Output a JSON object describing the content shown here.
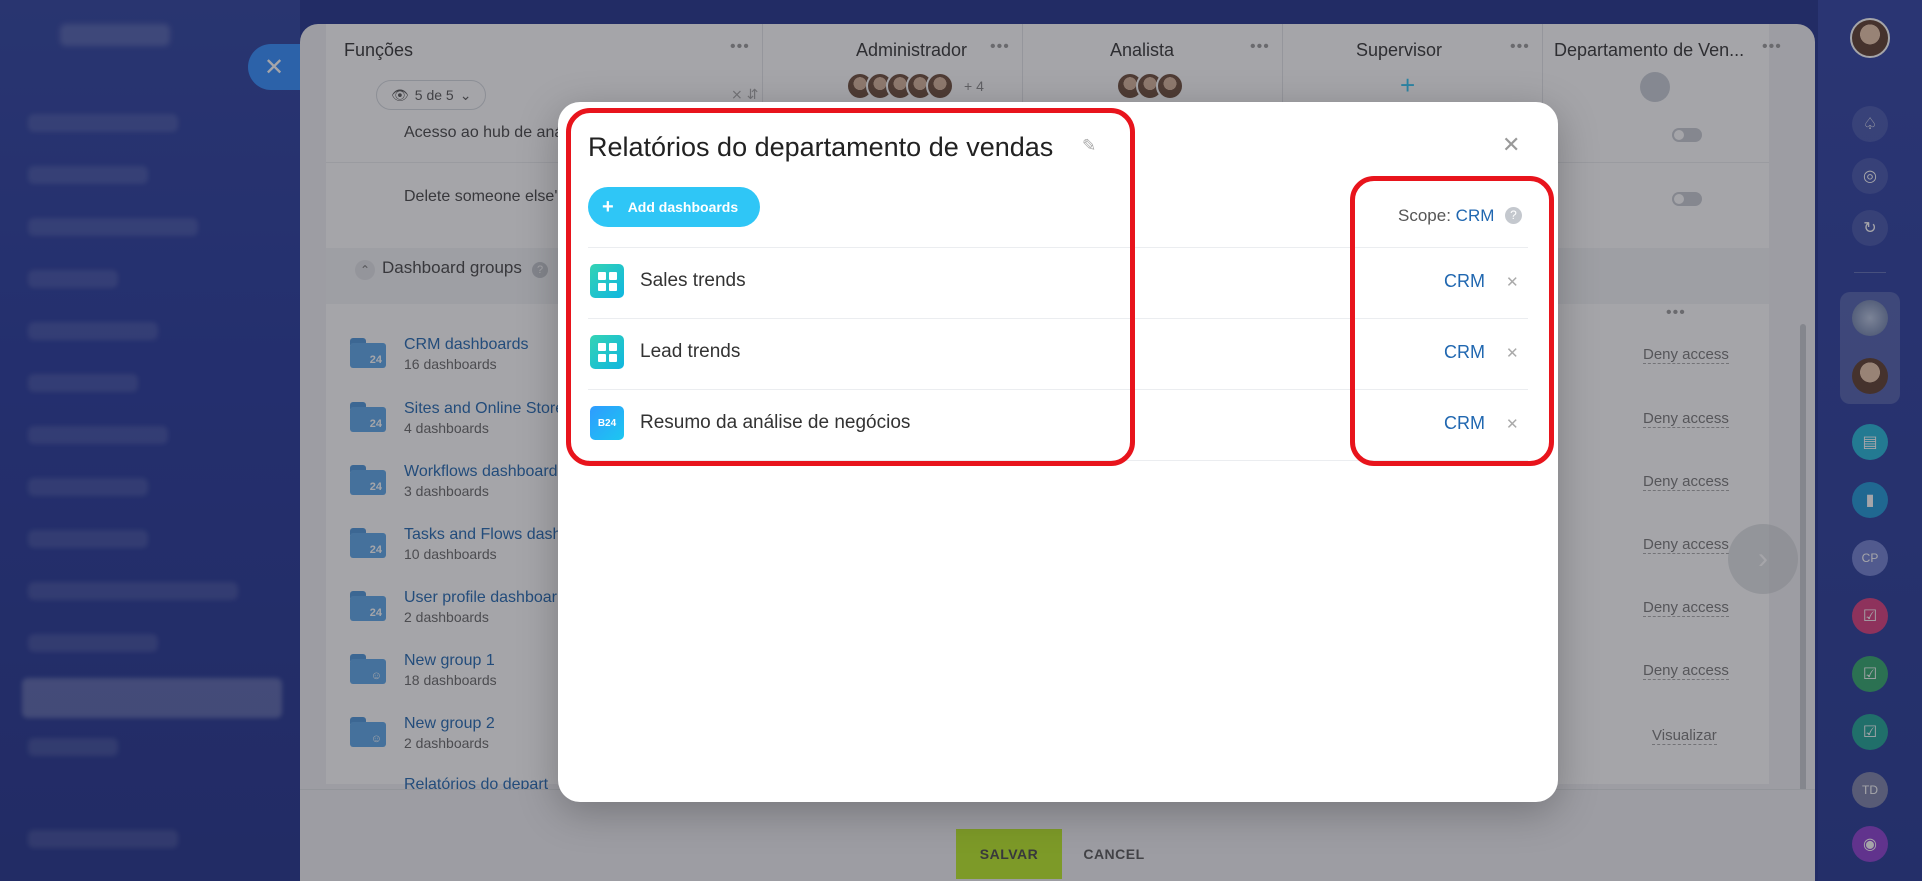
{
  "roles_panel": {
    "functions_header": "Funções",
    "filter_chip": "5 de 5",
    "columns": [
      "Administrador",
      "Analista",
      "Supervisor",
      "Departamento de Ven..."
    ],
    "admin_more": "+ 4",
    "rows": [
      "Acesso ao hub de análise",
      "Delete someone else's un"
    ],
    "section_title": "Dashboard groups",
    "groups": [
      {
        "name": "CRM dashboards",
        "count": "16 dashboards",
        "access": "Deny access"
      },
      {
        "name": "Sites and Online Store",
        "count": "4 dashboards",
        "access": "Deny access"
      },
      {
        "name": "Workflows dashboard",
        "count": "3 dashboards",
        "access": "Deny access"
      },
      {
        "name": "Tasks and Flows dashb",
        "count": "10 dashboards",
        "access": "Deny access"
      },
      {
        "name": "User profile dashboar",
        "count": "2 dashboards",
        "access": "Deny access"
      },
      {
        "name": "New group 1",
        "count": "18 dashboards",
        "access": "Deny access"
      },
      {
        "name": "New group 2",
        "count": "2 dashboards",
        "access": "Visualizar"
      },
      {
        "name": "Relatórios do depart",
        "count": "",
        "access": ""
      }
    ],
    "folder_badge": "24"
  },
  "footer": {
    "save_label": "SALVAR",
    "cancel_label": "CANCEL"
  },
  "modal": {
    "title": "Relatórios do departamento de vendas",
    "add_button": "Add dashboards",
    "scope_label": "Scope:",
    "scope_value": "CRM",
    "dashboards": [
      {
        "name": "Sales trends",
        "scope": "CRM",
        "icon": "grid-dashboard-icon"
      },
      {
        "name": "Lead trends",
        "scope": "CRM",
        "icon": "grid-dashboard-icon"
      },
      {
        "name": "Resumo da análise de negócios",
        "scope": "CRM",
        "icon": "b24-icon"
      }
    ],
    "b24_label": "B24"
  },
  "colors": {
    "accent": "#2fc6f6",
    "link": "#2067b0",
    "highlight": "#e8141c",
    "save": "#bbed21"
  }
}
